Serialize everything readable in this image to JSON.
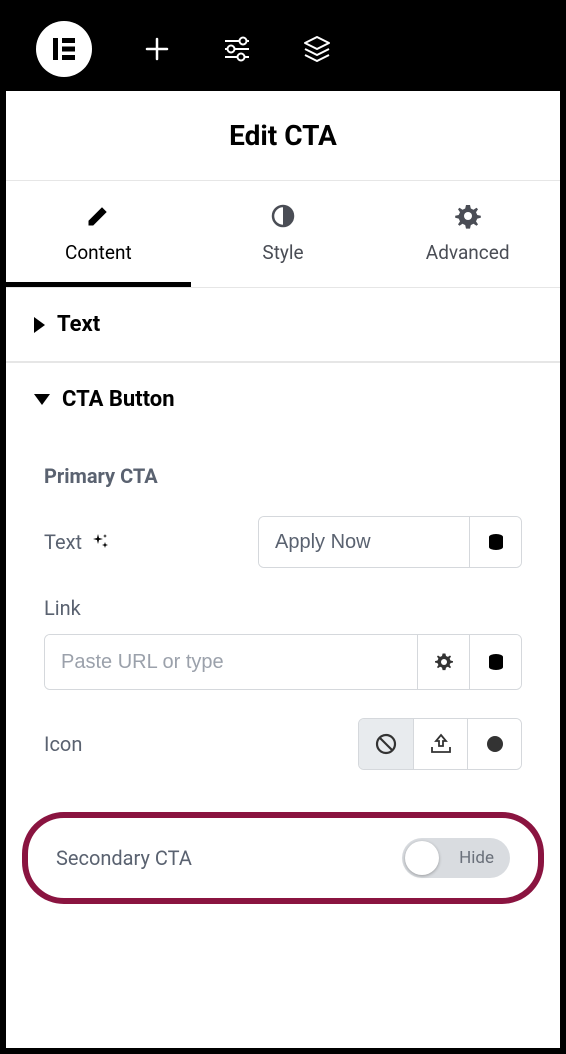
{
  "panel": {
    "title": "Edit CTA"
  },
  "tabs": {
    "content": "Content",
    "style": "Style",
    "advanced": "Advanced"
  },
  "sections": {
    "text": "Text",
    "cta_button": "CTA Button"
  },
  "primary": {
    "heading": "Primary CTA",
    "text_label": "Text",
    "text_value": "Apply Now",
    "link_label": "Link",
    "link_placeholder": "Paste URL or type",
    "link_value": "",
    "icon_label": "Icon"
  },
  "secondary": {
    "label": "Secondary CTA",
    "toggle_state": "Hide"
  }
}
